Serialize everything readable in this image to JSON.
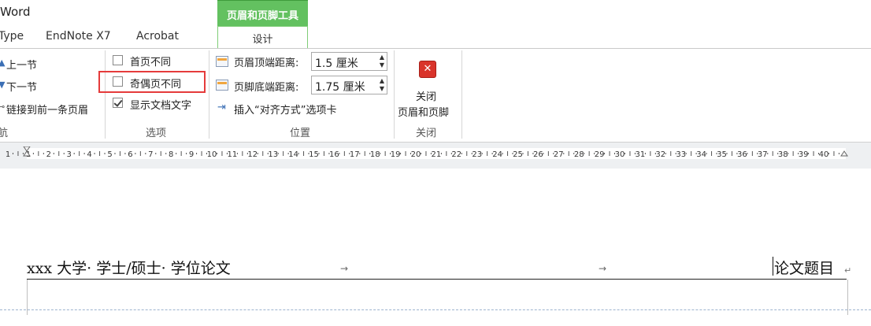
{
  "app": {
    "title": "Word"
  },
  "context_tab": {
    "group_label": "页眉和页脚工具",
    "tab_label": "设计"
  },
  "tabs": [
    {
      "label": "Type"
    },
    {
      "label": "EndNote X7"
    },
    {
      "label": "Acrobat"
    }
  ],
  "navigation": {
    "prev_section": "上一节",
    "next_section": "下一节",
    "link_previous": "链接到前一条页眉",
    "group_label": "航"
  },
  "options": {
    "group_label": "选项",
    "items": [
      {
        "label": "首页不同",
        "checked": false
      },
      {
        "label": "奇偶页不同",
        "checked": false
      },
      {
        "label": "显示文档文字",
        "checked": true
      }
    ]
  },
  "position": {
    "group_label": "位置",
    "header_top_label": "页眉顶端距离:",
    "header_top_value": "1.5 厘米",
    "footer_bottom_label": "页脚底端距离:",
    "footer_bottom_value": "1.75 厘米",
    "insert_alignment_tab": "插入“对齐方式”选项卡"
  },
  "close": {
    "label_line1": "关闭",
    "label_line2": "页眉和页脚",
    "group_label": "关闭"
  },
  "ruler": {
    "ticks": [
      "1",
      "1",
      "2",
      "3",
      "4",
      "5",
      "6",
      "7",
      "8",
      "9",
      "10",
      "11",
      "12",
      "13",
      "14",
      "15",
      "16",
      "17",
      "18",
      "19",
      "20",
      "21",
      "22",
      "23",
      "24",
      "25",
      "26",
      "27",
      "28",
      "29",
      "30",
      "31",
      "32",
      "33",
      "34",
      "35",
      "36",
      "37",
      "38",
      "39",
      "40"
    ]
  },
  "document": {
    "header_left": "xxx 大学· 学士/硕士· 学位论文",
    "header_right": "论文题目",
    "tab_mark": "→",
    "paragraph_mark": "↵"
  },
  "colors": {
    "context_green": "#63c160",
    "highlight_red": "#e53b3b",
    "close_red": "#d9342b"
  }
}
